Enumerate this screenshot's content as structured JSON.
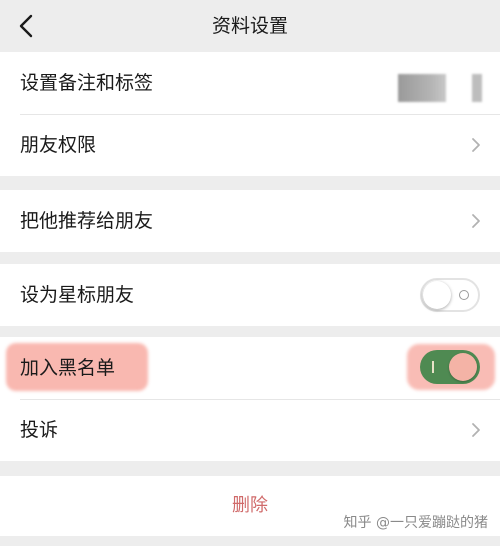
{
  "header": {
    "title": "资料设置",
    "back_icon": "chevron-left-icon"
  },
  "groups": [
    {
      "rows": [
        {
          "label": "设置备注和标签",
          "tags": "blurred"
        },
        {
          "label": "朋友权限",
          "icon": "chevron-right-icon"
        }
      ]
    },
    {
      "rows": [
        {
          "label": "把他推荐给朋友",
          "icon": "chevron-right-icon"
        }
      ]
    },
    {
      "rows": [
        {
          "label": "设为星标朋友",
          "toggle": "off"
        }
      ]
    },
    {
      "rows": [
        {
          "label": "加入黑名单",
          "toggle": "on"
        },
        {
          "label": "投诉",
          "icon": "chevron-right-icon"
        }
      ]
    }
  ],
  "delete": {
    "label": "删除"
  },
  "watermark": "知乎 @一只爱蹦跶的猪",
  "colors": {
    "background": "#ededed",
    "row_background": "#ffffff",
    "toggle_on": "#4f8a52",
    "delete_text": "#d06a6a",
    "highlight": "#f7a096"
  }
}
